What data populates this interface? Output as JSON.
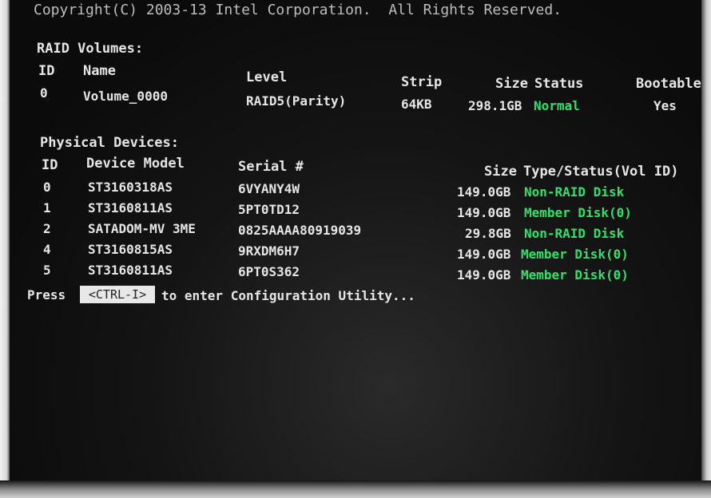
{
  "copyright": "Copyright(C) 2003-13 Intel Corporation.  All Rights Reserved.",
  "raid": {
    "title": "RAID Volumes:",
    "headers": {
      "id": "ID",
      "name": "Name",
      "level": "Level",
      "strip": "Strip",
      "size": "Size",
      "status": "Status",
      "bootable": "Bootable"
    },
    "volumes": [
      {
        "id": "0",
        "name": "Volume_0000",
        "level": "RAID5(Parity)",
        "strip": "64KB",
        "size": "298.1GB",
        "status": "Normal",
        "bootable": "Yes"
      }
    ]
  },
  "physical": {
    "title": "Physical Devices:",
    "headers": {
      "id": "ID",
      "model": "Device Model",
      "serial": "Serial #",
      "size": "Size",
      "type": "Type/Status(Vol ID)"
    },
    "devices": [
      {
        "id": "0",
        "model": "ST3160318AS",
        "serial": "6VYANY4W",
        "size": "149.0GB",
        "type": "Non-RAID Disk"
      },
      {
        "id": "1",
        "model": "ST3160811AS",
        "serial": "5PT0TD12",
        "size": "149.0GB",
        "type": "Member Disk(0)"
      },
      {
        "id": "2",
        "model": "SATADOM-MV 3ME",
        "serial": "0825AAAA80919039",
        "size": "29.8GB",
        "type": "Non-RAID Disk"
      },
      {
        "id": "4",
        "model": "ST3160815AS",
        "serial": "9RXDM6H7",
        "size": "149.0GB",
        "type": "Member Disk(0)"
      },
      {
        "id": "5",
        "model": "ST3160811AS",
        "serial": "6PT0S362",
        "size": "149.0GB",
        "type": "Member Disk(0)"
      }
    ]
  },
  "prompt": {
    "press": "Press",
    "key": "<CTRL-I>",
    "rest": "to enter Configuration Utility..."
  },
  "colors": {
    "text": "#e6e6e6",
    "status_green": "#2fe06a",
    "highlight_bg": "#e8e8e8"
  }
}
